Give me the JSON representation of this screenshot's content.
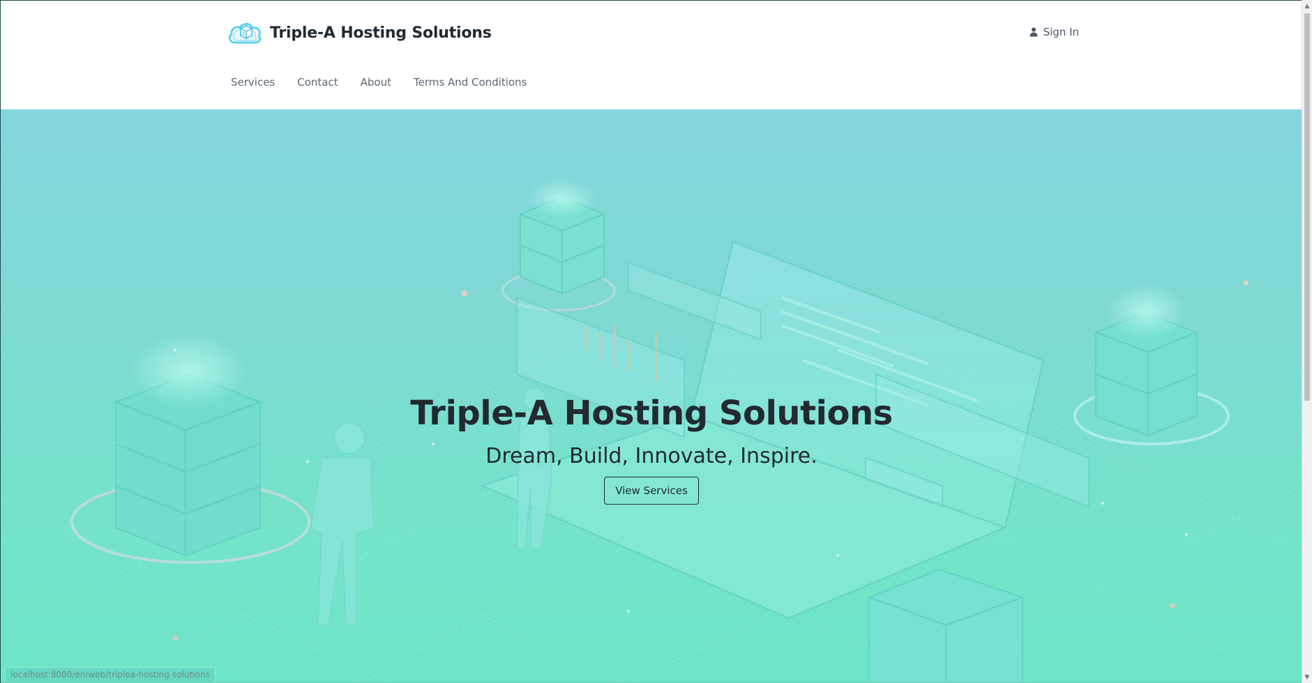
{
  "header": {
    "brand_name": "Triple-A Hosting Solutions",
    "logo_icon": "cloud-server-logo-icon",
    "sign_in_label": "Sign In",
    "sign_in_icon": "user-icon",
    "nav": [
      {
        "label": "Services"
      },
      {
        "label": "Contact"
      },
      {
        "label": "About"
      },
      {
        "label": "Terms And Conditions"
      }
    ]
  },
  "hero": {
    "title": "Triple-A Hosting Solutions",
    "subtitle": "Dream, Build, Innovate, Inspire.",
    "button_label": "View Services",
    "illustration": "isometric-cloud-servers-illustration"
  },
  "status_bar": {
    "url": "localhost:8080/en/web/triplea-hosting-solutions"
  },
  "scrollbar": {
    "up_icon": "scroll-up-arrow-icon",
    "down_icon": "scroll-down-arrow-icon"
  },
  "colors": {
    "brand_text": "#1f2a33",
    "hero_top": "#86d4df",
    "hero_bottom": "#6ae6c4",
    "logo_accent": "#4fc9e8"
  }
}
